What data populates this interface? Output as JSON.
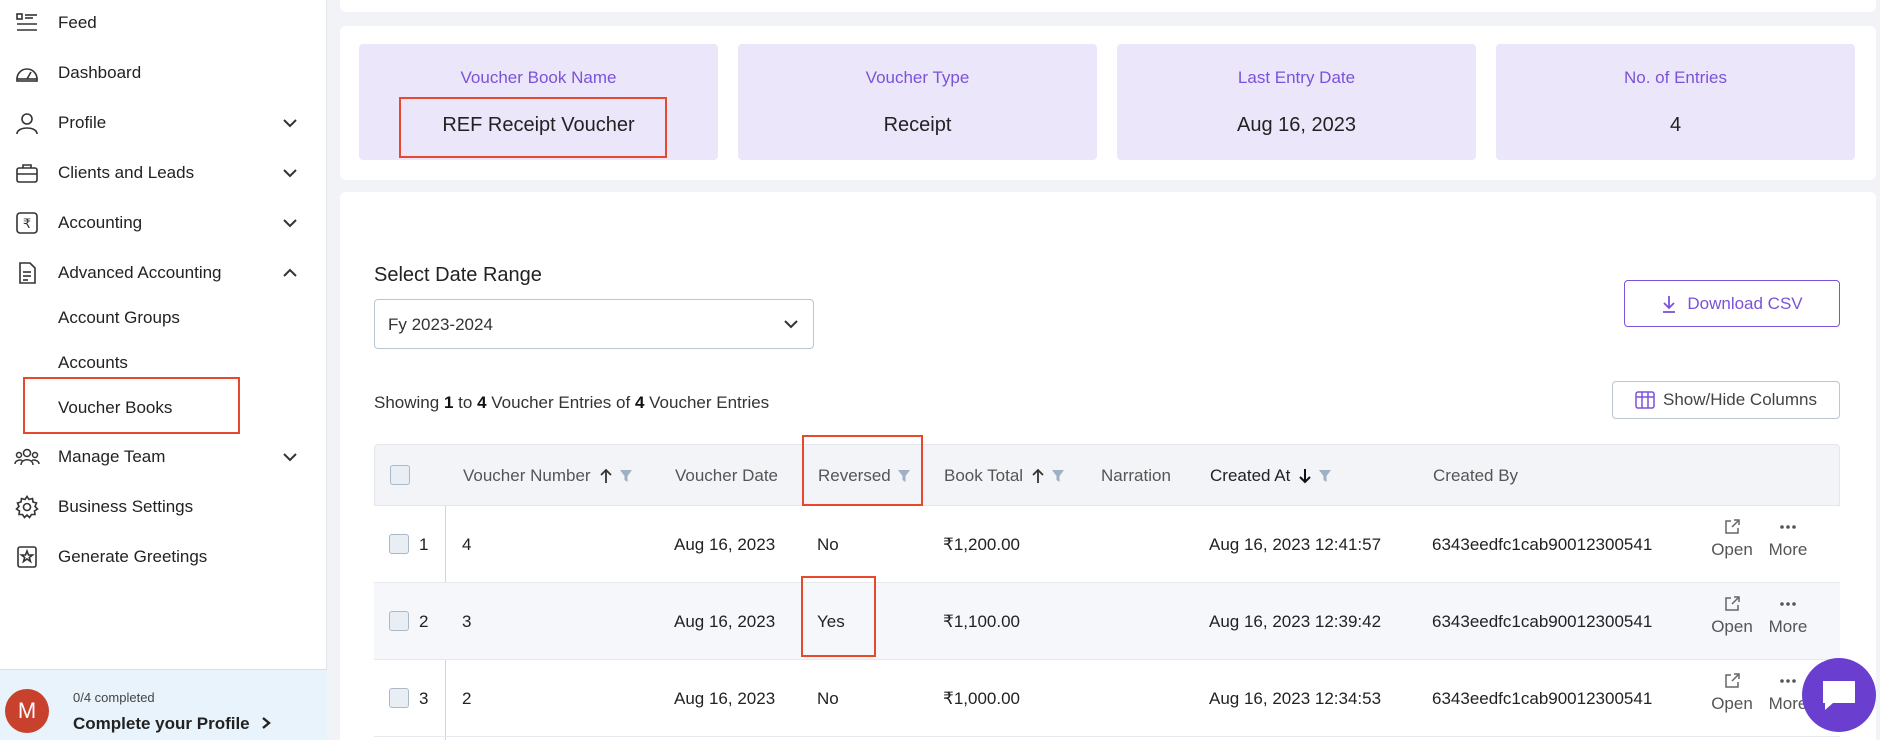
{
  "sidebar": {
    "items": [
      {
        "label": "Feed",
        "icon": "feed-icon"
      },
      {
        "label": "Dashboard",
        "icon": "dashboard-icon"
      },
      {
        "label": "Profile",
        "icon": "user-icon"
      },
      {
        "label": "Clients and Leads",
        "icon": "briefcase-icon"
      },
      {
        "label": "Accounting",
        "icon": "rupee-icon"
      },
      {
        "label": "Advanced Accounting",
        "icon": "document-icon"
      },
      {
        "label": "Manage Team",
        "icon": "team-icon"
      },
      {
        "label": "Business Settings",
        "icon": "gear-icon"
      },
      {
        "label": "Generate Greetings",
        "icon": "greeting-icon"
      }
    ],
    "subitems": [
      "Account Groups",
      "Accounts",
      "Voucher Books"
    ],
    "profile_card": {
      "avatar_letter": "M",
      "progress": "0/4 completed",
      "cta": "Complete your Profile"
    }
  },
  "summary": {
    "cards": [
      {
        "key": "Voucher Book Name",
        "value": "REF Receipt Voucher"
      },
      {
        "key": "Voucher Type",
        "value": "Receipt"
      },
      {
        "key": "Last Entry Date",
        "value": "Aug 16, 2023"
      },
      {
        "key": "No. of Entries",
        "value": "4"
      }
    ]
  },
  "filters": {
    "date_range_label": "Select Date Range",
    "date_range_value": "Fy 2023-2024",
    "download_label": "Download CSV",
    "show_hide_label": "Show/Hide Columns"
  },
  "showing": {
    "prefix": "Showing",
    "from": "1",
    "to_word": "to",
    "to": "4",
    "entries_word": "Voucher Entries",
    "of_word": "of",
    "total": "4",
    "suffix": "Voucher Entries"
  },
  "table": {
    "columns": [
      "Voucher Number",
      "Voucher Date",
      "Reversed",
      "Book Total",
      "Narration",
      "Created At",
      "Created By"
    ],
    "rows": [
      {
        "index": "1",
        "voucher_number": "4",
        "voucher_date": "Aug 16, 2023",
        "reversed": "No",
        "book_total": "₹1,200.00",
        "narration": "",
        "created_at": "Aug 16, 2023 12:41:57",
        "created_by": "6343eedfc1cab90012300541"
      },
      {
        "index": "2",
        "voucher_number": "3",
        "voucher_date": "Aug 16, 2023",
        "reversed": "Yes",
        "book_total": "₹1,100.00",
        "narration": "",
        "created_at": "Aug 16, 2023 12:39:42",
        "created_by": "6343eedfc1cab90012300541"
      },
      {
        "index": "3",
        "voucher_number": "2",
        "voucher_date": "Aug 16, 2023",
        "reversed": "No",
        "book_total": "₹1,000.00",
        "narration": "",
        "created_at": "Aug 16, 2023 12:34:53",
        "created_by": "6343eedfc1cab90012300541"
      }
    ],
    "actions": {
      "open": "Open",
      "more": "More"
    }
  },
  "colors": {
    "accent": "#7b52d9",
    "card_bg": "#ece6fb",
    "highlight": "#e8492c",
    "chat": "#6a3fd0"
  }
}
